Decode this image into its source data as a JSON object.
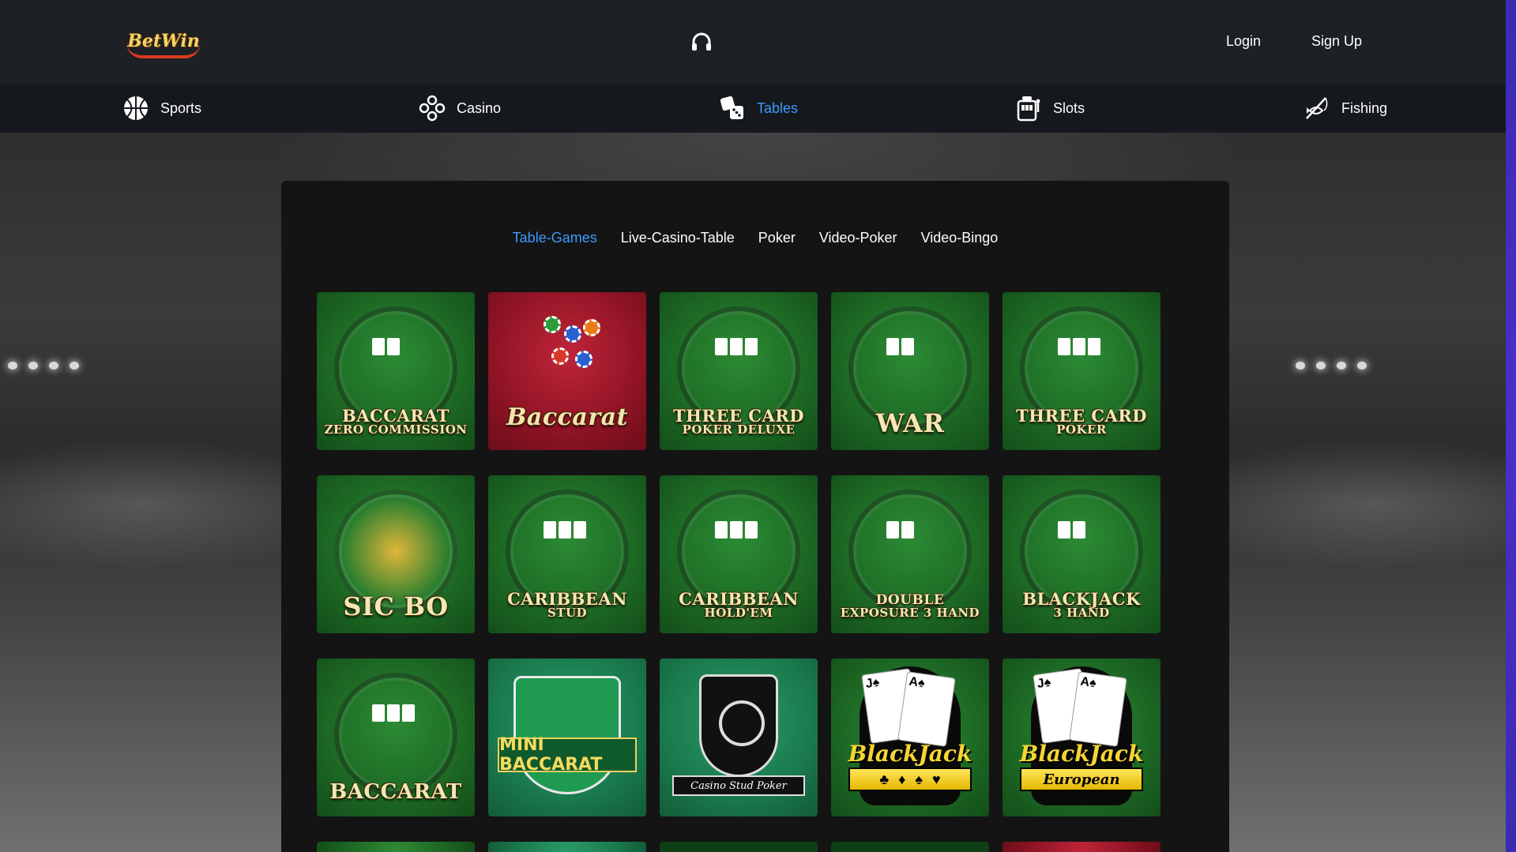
{
  "header": {
    "logo_text": "BetWin",
    "login_label": "Login",
    "signup_label": "Sign Up"
  },
  "nav": {
    "items": [
      {
        "label": "Sports",
        "icon": "basketball-icon"
      },
      {
        "label": "Casino",
        "icon": "chips-icon"
      },
      {
        "label": "Tables",
        "icon": "dice-icon",
        "active": true
      },
      {
        "label": "Slots",
        "icon": "slot-machine-icon"
      },
      {
        "label": "Fishing",
        "icon": "fishing-icon"
      }
    ]
  },
  "tabs": {
    "items": [
      "Table-Games",
      "Live-Casino-Table",
      "Poker",
      "Video-Poker",
      "Video-Bingo"
    ],
    "active": "Table-Games"
  },
  "games": {
    "row1": [
      {
        "line1": "BACCARAT",
        "line2": "ZERO COMMISSION"
      },
      {
        "line1": "Baccarat",
        "line2": ""
      },
      {
        "line1": "THREE CARD",
        "line2": "POKER DELUXE"
      },
      {
        "line1": "WAR",
        "line2": ""
      },
      {
        "line1": "THREE CARD",
        "line2": "POKER"
      }
    ],
    "row2": [
      {
        "line1": "SIC BO",
        "line2": ""
      },
      {
        "line1": "CARIBBEAN",
        "line2": "STUD"
      },
      {
        "line1": "CARIBBEAN",
        "line2": "HOLD'EM"
      },
      {
        "line1": "DOUBLE",
        "line2": "EXPOSURE 3 HAND"
      },
      {
        "line1": "BLACKJACK",
        "line2": "3 HAND"
      }
    ],
    "row3": [
      {
        "line1": "BACCARAT",
        "line2": ""
      },
      {
        "line1": "MINI BACCARAT",
        "line2": ""
      },
      {
        "line1": "Casino Stud Poker",
        "line2": ""
      },
      {
        "line1": "BlackJack",
        "line2": ""
      },
      {
        "line1": "BlackJack",
        "line2": "European"
      }
    ]
  }
}
